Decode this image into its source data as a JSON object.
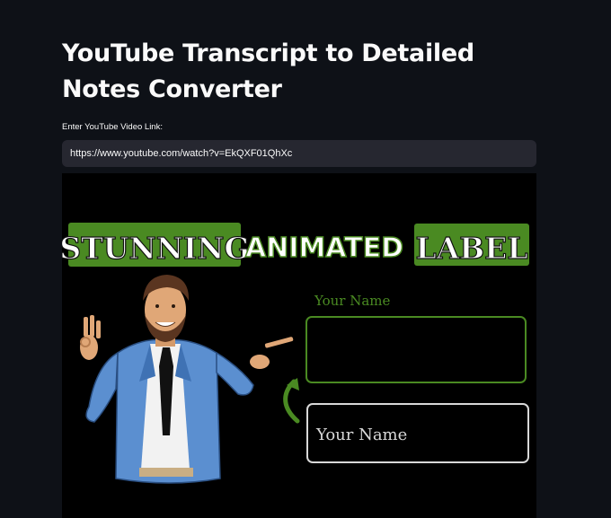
{
  "page": {
    "title": "YouTube Transcript to Detailed Notes Converter"
  },
  "form": {
    "label": "Enter YouTube Video Link:",
    "value": "https://www.youtube.com/watch?v=EkQXF01QhXc"
  },
  "thumbnail": {
    "word1": "STUNNING",
    "word2": "ANIMATED",
    "word3": "LABEL",
    "field_label_top": "Your Name",
    "field_placeholder": "Your Name",
    "accent_color": "#4a8a22",
    "background_color": "#000000"
  }
}
